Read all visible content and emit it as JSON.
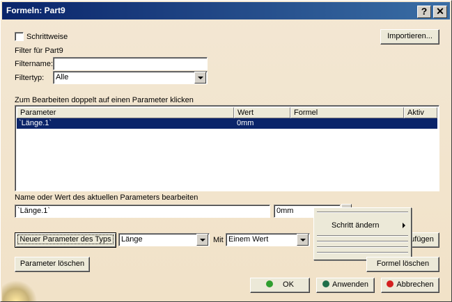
{
  "window": {
    "title": "Formeln: Part9",
    "help_label": "?",
    "close_label": "✕"
  },
  "top": {
    "step_checkbox_label": "Schrittweise",
    "import_label": "Importieren..."
  },
  "filter": {
    "section_label": "Filter für Part9",
    "name_label": "Filtername:",
    "name_value": "",
    "type_label": "Filtertyp:",
    "type_value": "Alle"
  },
  "params": {
    "hint": "Zum Bearbeiten doppelt auf einen Parameter klicken",
    "columns": [
      "Parameter",
      "Wert",
      "Formel",
      "Aktiv"
    ],
    "rows": [
      {
        "parameter": "`Länge.1`",
        "wert": "0mm",
        "formel": "",
        "aktiv": ""
      }
    ]
  },
  "edit": {
    "label": "Name oder Wert des aktuellen Parameters bearbeiten",
    "name_value": "`Länge.1`",
    "value_value": "0mm"
  },
  "new_param": {
    "button_label": "Neuer Parameter des Typs",
    "type_value": "Länge",
    "with_label": "Mit",
    "mode_value": "Einem Wert",
    "add_label": "ufügen"
  },
  "context_menu": {
    "item_label": "Schritt ändern"
  },
  "actions": {
    "delete_param_label": "Parameter löschen",
    "delete_formula_label": "Formel löschen",
    "ok_label": "OK",
    "apply_label": "Anwenden",
    "cancel_label": "Abbrechen"
  },
  "colors": {
    "ok_dot": "#2f9e2f",
    "apply_dot": "#1f6f4a",
    "cancel_dot": "#d42020",
    "selection": "#0a246a"
  }
}
